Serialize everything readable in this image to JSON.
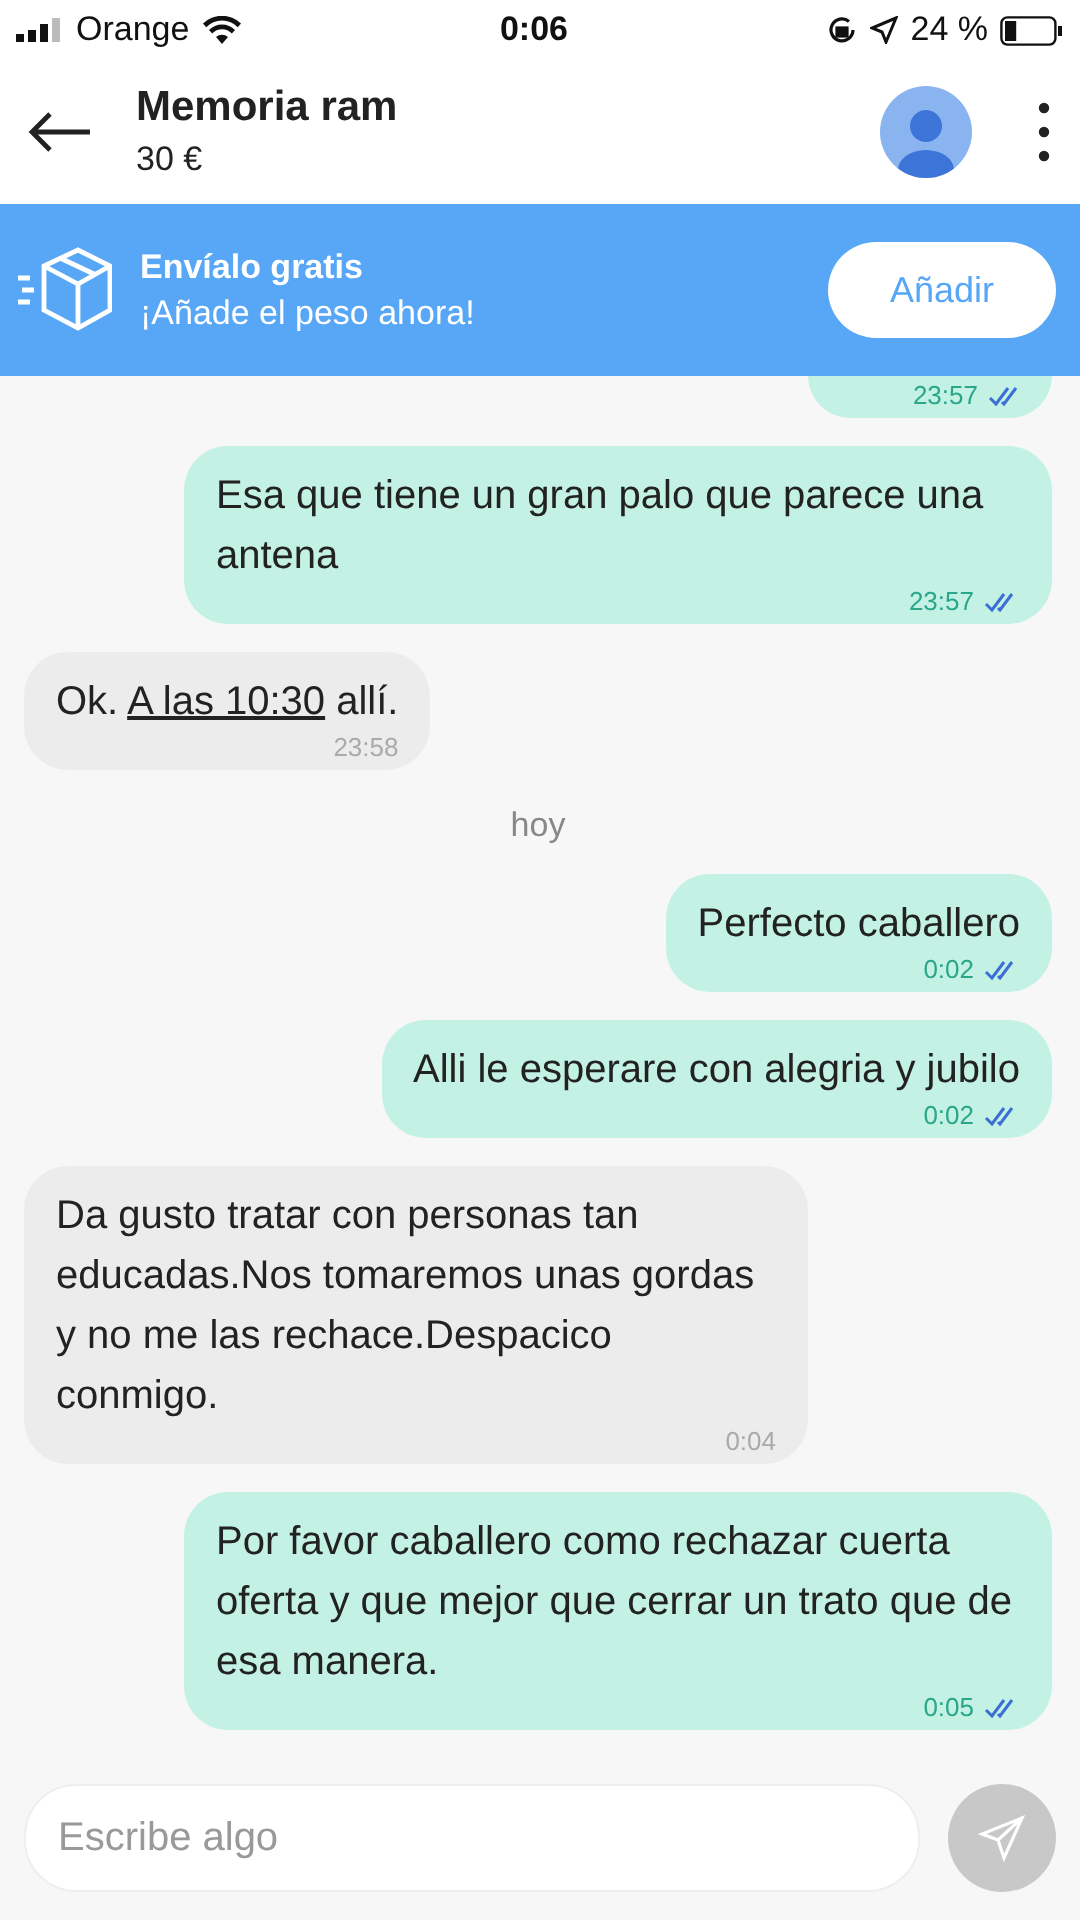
{
  "status_bar": {
    "carrier": "Orange",
    "time": "0:06",
    "battery": "24 %"
  },
  "header": {
    "title": "Memoria ram",
    "price": "30 €"
  },
  "banner": {
    "title": "Envíalo gratis",
    "subtitle": "¡Añade el peso ahora!",
    "button": "Añadir"
  },
  "messages": [
    {
      "kind": "sent",
      "time": "23:57",
      "read": true
    },
    {
      "kind": "sent",
      "parts": [
        {
          "kind": "plain",
          "text": "Esa que tiene un gran palo que parece una antena"
        }
      ],
      "time": "23:57",
      "read": true
    },
    {
      "kind": "received",
      "parts": [
        {
          "kind": "plain",
          "text": "Ok. "
        },
        {
          "kind": "link",
          "text": "A las 10:30"
        },
        {
          "kind": "plain",
          "text": " allí."
        }
      ],
      "time": "23:58"
    },
    {
      "kind": "day",
      "text": "hoy"
    },
    {
      "kind": "sent",
      "parts": [
        {
          "kind": "plain",
          "text": "Perfecto caballero"
        }
      ],
      "time": "0:02",
      "read": true
    },
    {
      "kind": "sent",
      "parts": [
        {
          "kind": "plain",
          "text": "Alli le esperare con alegria y jubilo"
        }
      ],
      "time": "0:02",
      "read": true
    },
    {
      "kind": "received",
      "parts": [
        {
          "kind": "plain",
          "text": "Da gusto tratar con personas tan educadas.Nos tomaremos unas gordas y no me las rechace.Despacico conmigo."
        }
      ],
      "time": "0:04"
    },
    {
      "kind": "sent",
      "parts": [
        {
          "kind": "plain",
          "text": "Por favor caballero como rechazar cuerta oferta y que mejor que cerrar un trato que de esa manera."
        }
      ],
      "time": "0:05",
      "read": true
    }
  ],
  "composer": {
    "placeholder": "Escribe algo"
  }
}
